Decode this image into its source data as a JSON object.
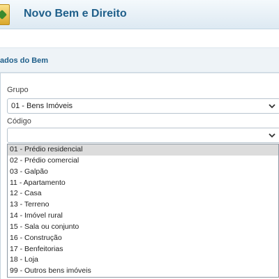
{
  "header": {
    "title": "Novo Bem e Direito"
  },
  "section": {
    "title": "ados do Bem"
  },
  "form": {
    "grupo_label": "Grupo",
    "grupo_value": "01 - Bens Imóveis",
    "codigo_label": "Código",
    "codigo_value": ""
  },
  "dropdown": {
    "selected_index": 0,
    "options": [
      "01 - Prédio residencial",
      "02 - Prédio comercial",
      "03 - Galpão",
      "11 - Apartamento",
      "12 - Casa",
      "13 - Terreno",
      "14 - Imóvel rural",
      "15 - Sala ou conjunto",
      "16 - Construção",
      "17 - Benfeitorias",
      "18 - Loja",
      "99 - Outros bens imóveis"
    ]
  },
  "colors": {
    "header_text": "#1f5f8a",
    "selected_option": "#dcdcdc"
  }
}
